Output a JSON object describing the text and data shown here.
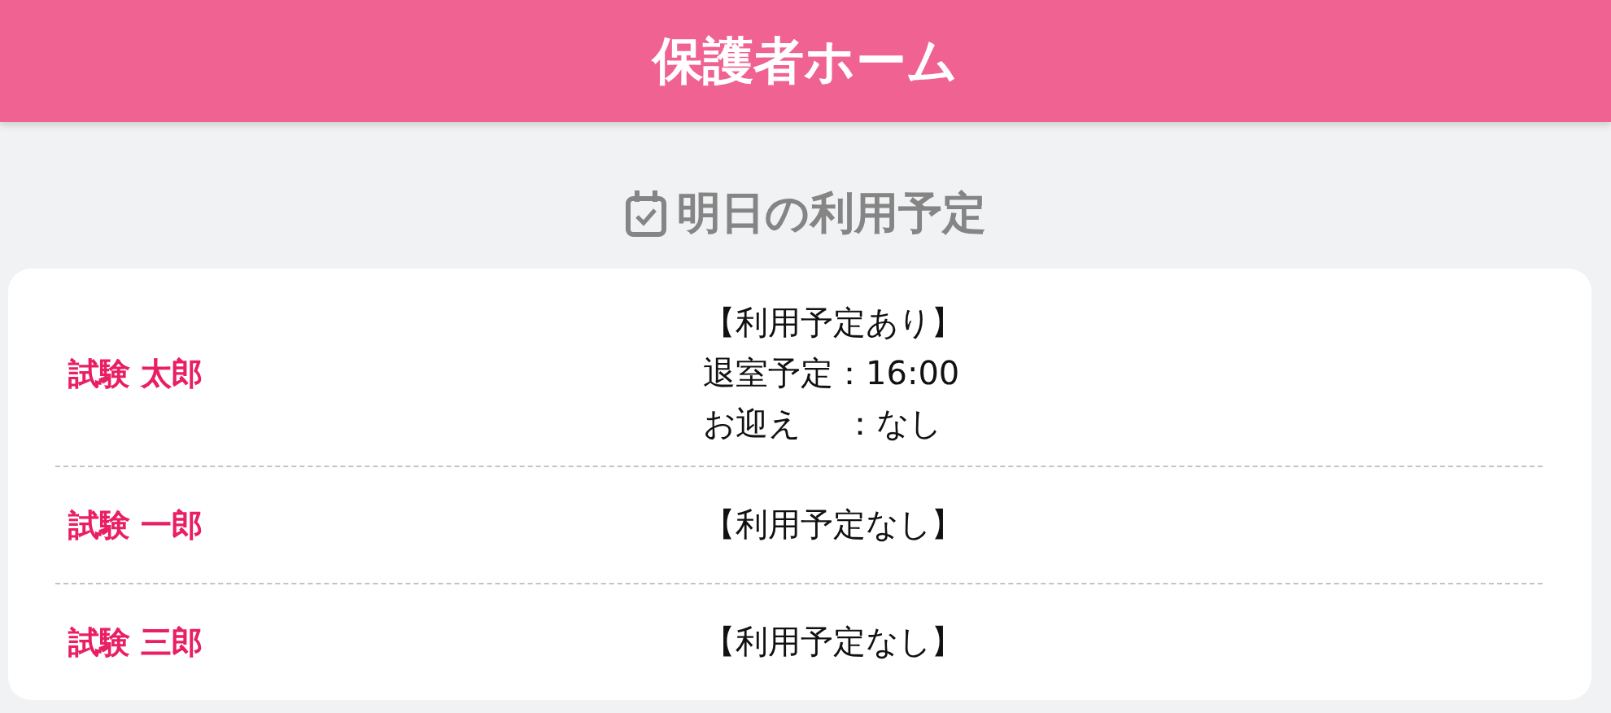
{
  "header": {
    "title": "保護者ホーム"
  },
  "section": {
    "title": "明日の利用予定"
  },
  "children": [
    {
      "name": "試験 太郎",
      "lines": [
        "【利用予定あり】",
        "退室予定：16:00",
        "お迎え　 ：なし"
      ]
    },
    {
      "name": "試験 一郎",
      "lines": [
        "【利用予定なし】"
      ]
    },
    {
      "name": "試験 三郎",
      "lines": [
        "【利用予定なし】"
      ]
    }
  ]
}
